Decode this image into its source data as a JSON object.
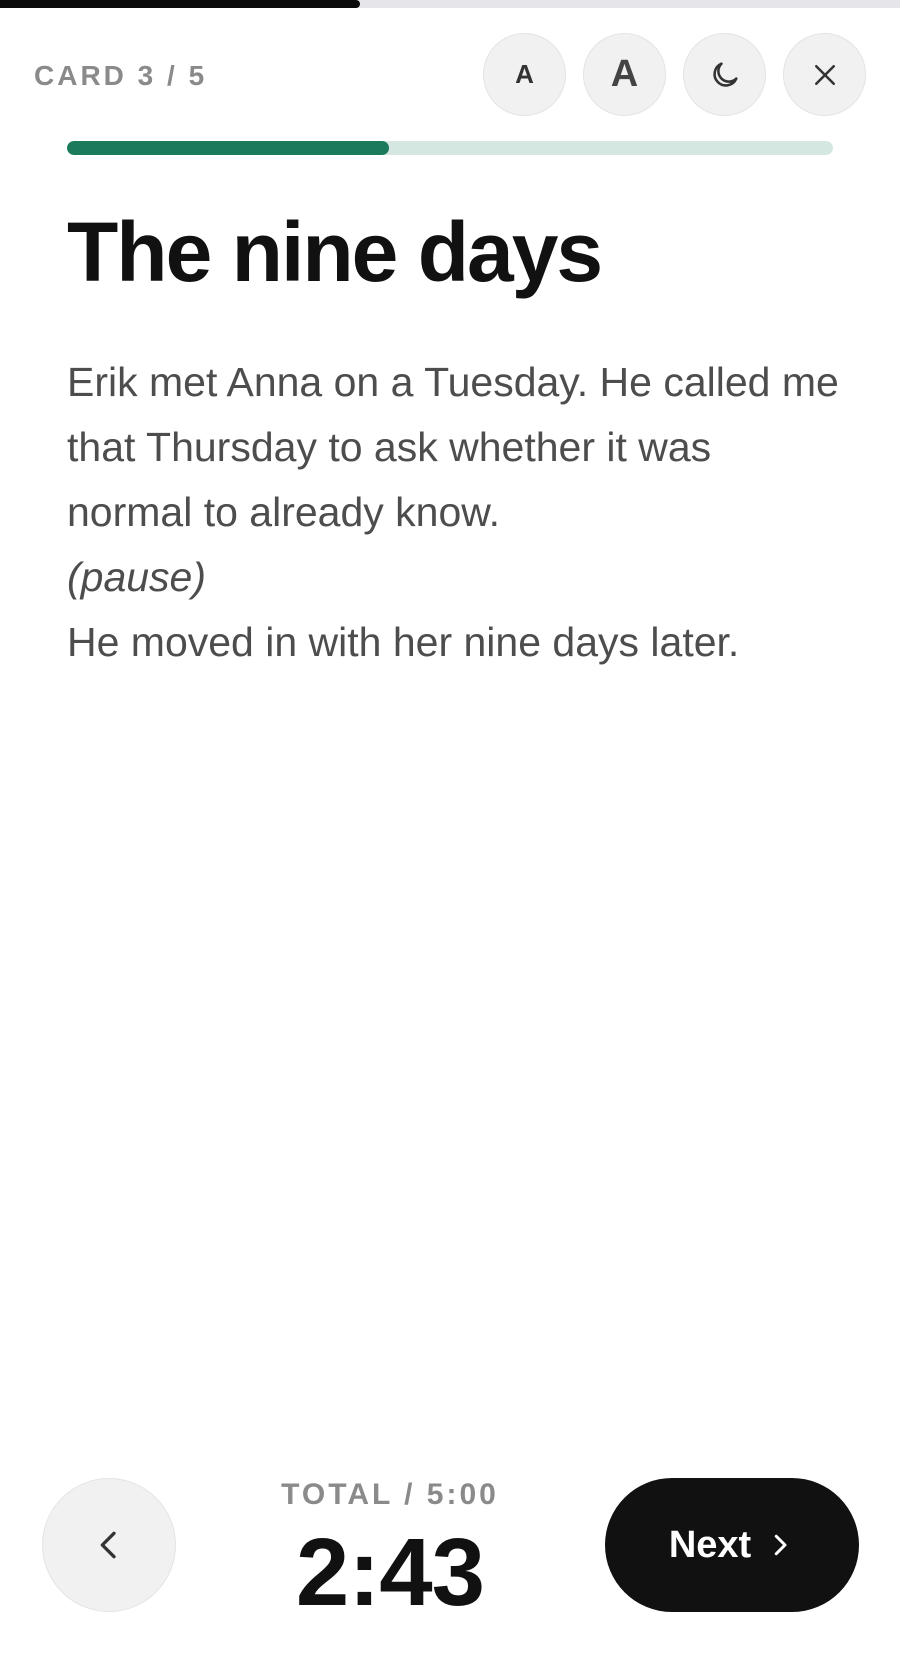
{
  "session": {
    "progress": 0.4
  },
  "header": {
    "card_counter": "CARD 3 / 5",
    "font_small_label": "A",
    "font_large_label": "A",
    "theme_icon": "moon-icon",
    "close_icon": "close-icon"
  },
  "card": {
    "progress": 0.42,
    "title": "The nine days",
    "body": [
      "Erik met Anna on a Tuesday. He called me that Thursday to ask whether it was normal to already know.",
      "(pause)",
      "He moved in with her nine days later."
    ]
  },
  "footer": {
    "prev_icon": "chevron-left-icon",
    "timer_label": "TOTAL / 5:00",
    "timer_value": "2:43",
    "next_label": "Next",
    "next_icon": "chevron-right-icon"
  },
  "colors": {
    "accent": "#1b7a5c",
    "accent_track": "#d4e8e1",
    "primary_button": "#111111"
  }
}
